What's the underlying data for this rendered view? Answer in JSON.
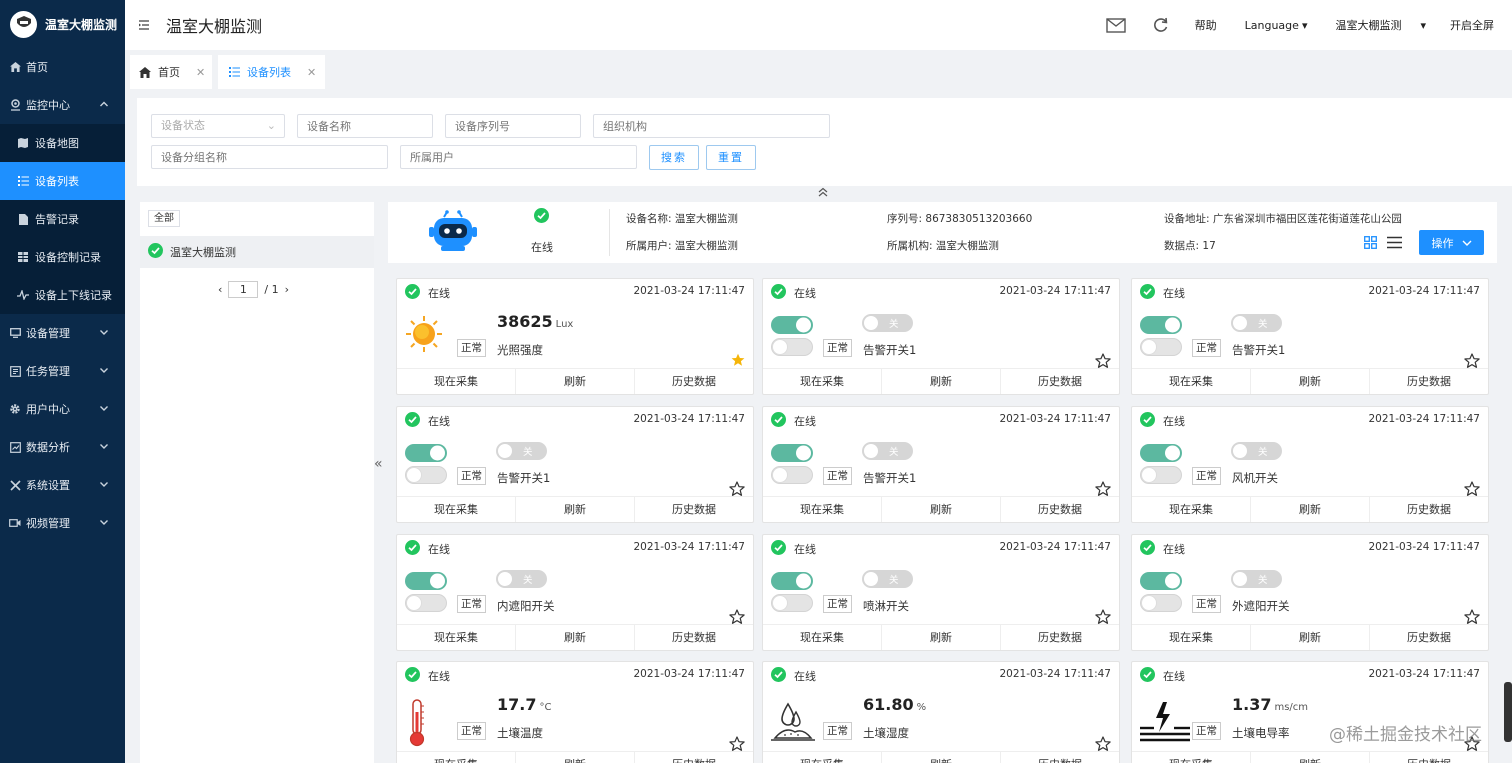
{
  "app": {
    "logo_text": "温室大棚监测"
  },
  "sidebar": {
    "items": [
      {
        "label": "首页",
        "icon": "home-icon"
      },
      {
        "label": "监控中心",
        "icon": "location-pin-icon",
        "expanded": true
      },
      {
        "label": "设备地图",
        "icon": "map-icon",
        "sub": true
      },
      {
        "label": "设备列表",
        "icon": "list-icon",
        "sub": true,
        "active": true
      },
      {
        "label": "告警记录",
        "icon": "document-icon",
        "sub": true
      },
      {
        "label": "设备控制记录",
        "icon": "table-icon",
        "sub": true
      },
      {
        "label": "设备上下线记录",
        "icon": "pulse-icon",
        "sub": true
      },
      {
        "label": "设备管理",
        "icon": "monitor-icon"
      },
      {
        "label": "任务管理",
        "icon": "task-icon"
      },
      {
        "label": "用户中心",
        "icon": "gear-icon"
      },
      {
        "label": "数据分析",
        "icon": "chart-icon"
      },
      {
        "label": "系统设置",
        "icon": "tools-icon"
      },
      {
        "label": "视频管理",
        "icon": "video-icon"
      }
    ]
  },
  "header": {
    "title": "温室大棚监测",
    "help": "帮助",
    "language": "Language",
    "org": "温室大棚监测",
    "fullscreen": "开启全屏"
  },
  "tabs": [
    {
      "label": "首页",
      "icon": "home-icon"
    },
    {
      "label": "设备列表",
      "icon": "list-icon",
      "active": true
    }
  ],
  "filters": {
    "status_placeholder": "设备状态",
    "name_placeholder": "设备名称",
    "serial_placeholder": "设备序列号",
    "org_placeholder": "组织机构",
    "group_placeholder": "设备分组名称",
    "user_placeholder": "所属用户",
    "search": "搜索",
    "reset": "重置"
  },
  "tree": {
    "all": "全部",
    "node": "温室大棚监测",
    "page_current": "1",
    "page_total": "/ 1"
  },
  "device": {
    "status": "在线",
    "name_label": "设备名称:",
    "name": "温室大棚监测",
    "user_label": "所属用户:",
    "user": "温室大棚监测",
    "serial_label": "序列号:",
    "serial": "8673830513203660",
    "org_label": "所属机构:",
    "org": "温室大棚监测",
    "address_label": "设备地址:",
    "address": "广东省深圳市福田区莲花街道莲花山公园",
    "points_label": "数据点:",
    "points": "17",
    "op_button": "操作"
  },
  "card_actions": [
    "现在采集",
    "刷新",
    "历史数据"
  ],
  "badge_normal": "正常",
  "switch_off": "关",
  "cards": [
    {
      "status": "在线",
      "time": "2021-03-24 17:11:47",
      "type": "sensor",
      "icon": "sun-icon",
      "value": "38625",
      "unit": "Lux",
      "name": "光照强度",
      "starred": true
    },
    {
      "status": "在线",
      "time": "2021-03-24 17:11:47",
      "type": "switch",
      "name": "告警开关1",
      "starred": false
    },
    {
      "status": "在线",
      "time": "2021-03-24 17:11:47",
      "type": "switch",
      "name": "告警开关1",
      "starred": false
    },
    {
      "status": "在线",
      "time": "2021-03-24 17:11:47",
      "type": "switch",
      "name": "告警开关1",
      "starred": false
    },
    {
      "status": "在线",
      "time": "2021-03-24 17:11:47",
      "type": "switch",
      "name": "告警开关1",
      "starred": false
    },
    {
      "status": "在线",
      "time": "2021-03-24 17:11:47",
      "type": "switch",
      "name": "风机开关",
      "starred": false
    },
    {
      "status": "在线",
      "time": "2021-03-24 17:11:47",
      "type": "switch",
      "name": "内遮阳开关",
      "starred": false
    },
    {
      "status": "在线",
      "time": "2021-03-24 17:11:47",
      "type": "switch",
      "name": "喷淋开关",
      "starred": false
    },
    {
      "status": "在线",
      "time": "2021-03-24 17:11:47",
      "type": "switch",
      "name": "外遮阳开关",
      "starred": false
    },
    {
      "status": "在线",
      "time": "2021-03-24 17:11:47",
      "type": "sensor",
      "icon": "thermometer-icon",
      "value": "17.7",
      "unit": "°C",
      "name": "土壤温度",
      "starred": false
    },
    {
      "status": "在线",
      "time": "2021-03-24 17:11:47",
      "type": "sensor",
      "icon": "soil-moisture-icon",
      "value": "61.80",
      "unit": "%",
      "name": "土壤湿度",
      "starred": false
    },
    {
      "status": "在线",
      "time": "2021-03-24 17:11:47",
      "type": "sensor",
      "icon": "conductivity-icon",
      "value": "1.37",
      "unit": "ms/cm",
      "name": "土壤电导率",
      "starred": false
    }
  ],
  "watermark": "@稀土掘金技术社区",
  "colors": {
    "sidebar_bg": "#0b2a4a",
    "accent": "#1e90ff",
    "success": "#22c55e",
    "switch_on": "#5cb8a0"
  }
}
